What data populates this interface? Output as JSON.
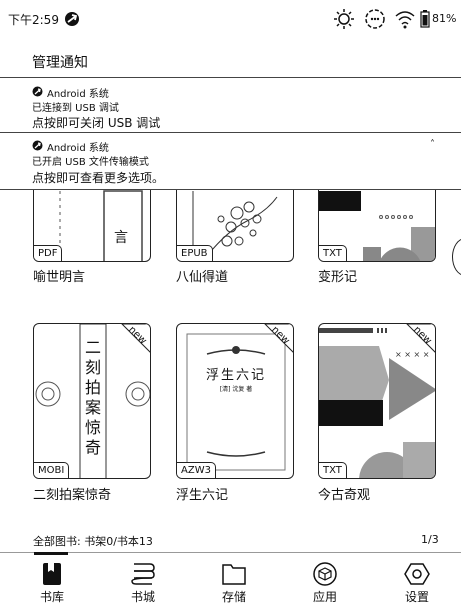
{
  "status_bar": {
    "time": "下午2:59",
    "battery": "81%"
  },
  "notification_shade": {
    "title": "管理通知",
    "notifications": [
      {
        "source": "Android 系统",
        "line1": "已连接到 USB 调试",
        "line2": "点按即可关闭 USB 调试"
      },
      {
        "source": "Android 系统",
        "line1": "已开启 USB 文件传输模式",
        "line2": "点按即可查看更多选项。",
        "expand": "˄"
      }
    ]
  },
  "books": [
    {
      "title": "喻世明言",
      "format": "PDF",
      "cover_text": "言",
      "new": false
    },
    {
      "title": "八仙得道",
      "format": "EPUB",
      "new": false
    },
    {
      "title": "变形记",
      "format": "TXT",
      "new": false
    },
    {
      "title": "二刻拍案惊奇",
      "format": "MOBI",
      "cover_text": "二刻拍案惊奇",
      "new": true,
      "badge": "new"
    },
    {
      "title": "浮生六记",
      "format": "AZW3",
      "cover_text": "浮生六记",
      "cover_sub": "[清] 沈复 著",
      "new": true,
      "badge": "new"
    },
    {
      "title": "今古奇观",
      "format": "TXT",
      "new": true,
      "badge": "new"
    }
  ],
  "footer": {
    "stats": "全部图书:  书架0/书本13",
    "page": "1/3"
  },
  "tabs": [
    {
      "label": "书库",
      "icon": "bookmark-book-icon",
      "active": true
    },
    {
      "label": "书城",
      "icon": "bookstore-icon"
    },
    {
      "label": "存储",
      "icon": "folder-icon"
    },
    {
      "label": "应用",
      "icon": "cube-icon"
    },
    {
      "label": "设置",
      "icon": "settings-hexagon-icon"
    }
  ]
}
